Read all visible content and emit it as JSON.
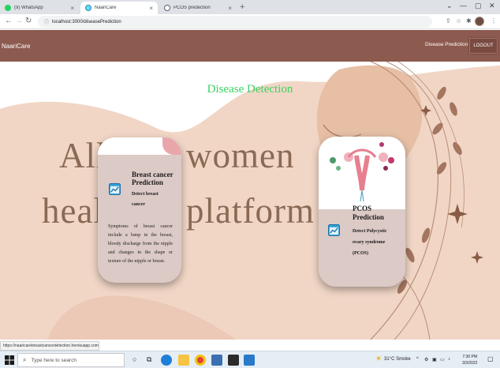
{
  "browser": {
    "tabs": [
      {
        "label": "(9) WhatsApp",
        "icon": "whatsapp-icon",
        "active": false
      },
      {
        "label": "NaariCare",
        "icon": "react-icon",
        "active": true
      },
      {
        "label": "PCOS predection",
        "icon": "globe-icon",
        "active": false
      }
    ],
    "url": "localhost:3000/diseasePrediction",
    "status_url": "https://naaricarebreastcancerdetection.herokuapp.com"
  },
  "app": {
    "brand": "NaariCare",
    "nav_link": "Disease Prediction",
    "logout": "LOGOUT"
  },
  "page": {
    "heading": "Disease Detection",
    "hero_line1_left": "All",
    "hero_line1_right": "women",
    "hero_line2_left": "healt",
    "hero_line2_right": "platform"
  },
  "cards": {
    "breast": {
      "title_line1": "Breast cancer",
      "title_line2": "Prediction",
      "sub_line1": "Detect breast",
      "sub_line2": "cancer",
      "desc": "Symptoms of breast cancer include a lump in the breast, bloody discharge from the nipple and changes in the shape or texture of the nipple or breast."
    },
    "pcos": {
      "title_line1": "PCOS",
      "title_line2": "Prediction",
      "sub_line1": "Detect Polycystic",
      "sub_line2": "ovary syndrome",
      "sub_line3": "(PCOS)"
    }
  },
  "taskbar": {
    "search_placeholder": "Type here to search",
    "weather": "31°C  Smoke",
    "time": "7:30 PM",
    "date": "3/3/2022"
  },
  "colors": {
    "header": "#8d5a4f",
    "heading": "#39d35f",
    "card": "#dccac6"
  }
}
